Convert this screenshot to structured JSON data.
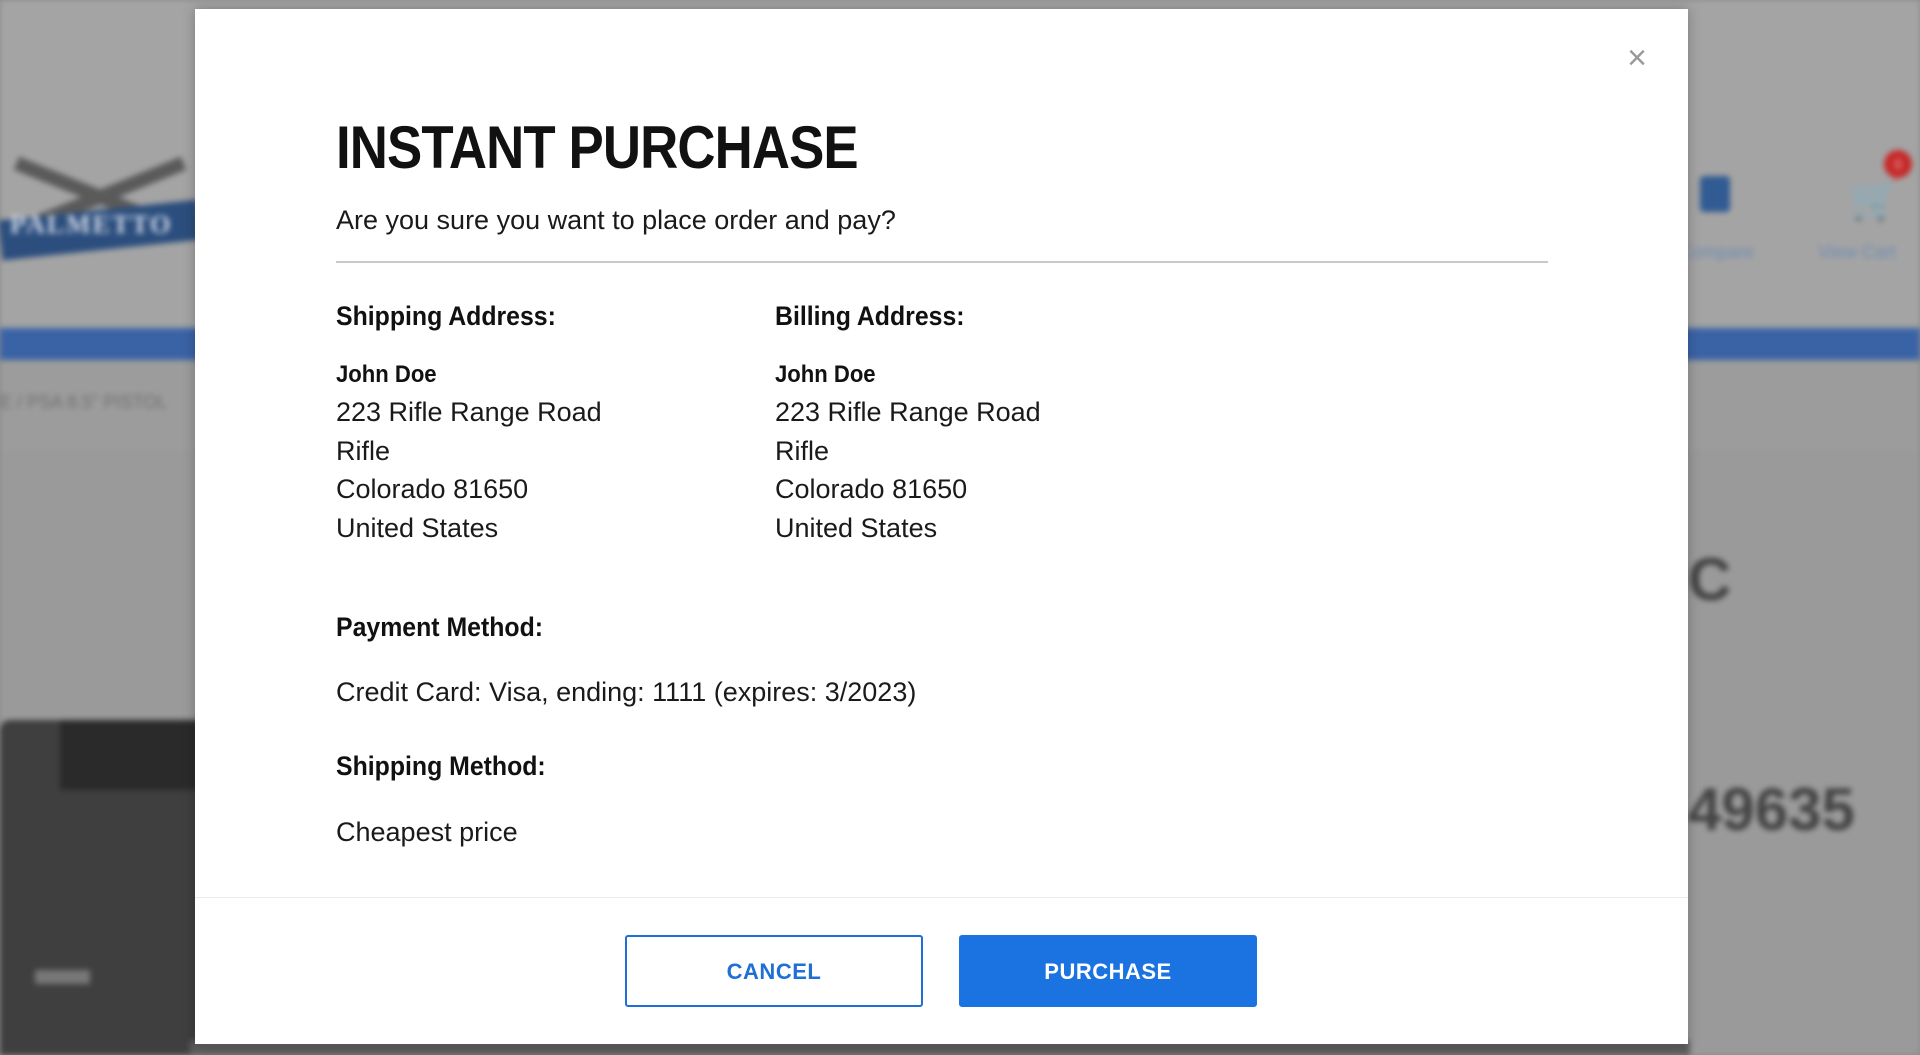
{
  "background": {
    "logo_text": "PALMETTO",
    "breadcrumb": "E / PSA 8.5\" PISTOL",
    "compare_label": "Compare",
    "cart_label": "View Cart",
    "cart_count": "0",
    "title_fragment": "C",
    "sku_fragment": "49635"
  },
  "modal": {
    "title": "INSTANT PURCHASE",
    "subtitle": "Are you sure you want to place order and pay?",
    "close_glyph": "×",
    "shipping": {
      "label": "Shipping Address:",
      "name": "John Doe",
      "street": "223 Rifle Range Road",
      "city": "Rifle",
      "state_zip": "Colorado 81650",
      "country": "United States"
    },
    "billing": {
      "label": "Billing Address:",
      "name": "John Doe",
      "street": "223 Rifle Range Road",
      "city": "Rifle",
      "state_zip": "Colorado 81650",
      "country": "United States"
    },
    "payment": {
      "label": "Payment Method:",
      "value": "Credit Card: Visa, ending: 1111 (expires: 3/2023)"
    },
    "shipping_method": {
      "label": "Shipping Method:",
      "value": "Cheapest price"
    },
    "buttons": {
      "cancel": "CANCEL",
      "purchase": "PURCHASE"
    }
  },
  "colors": {
    "primary": "#1a73e0",
    "overlay": "#8a8a8a"
  }
}
